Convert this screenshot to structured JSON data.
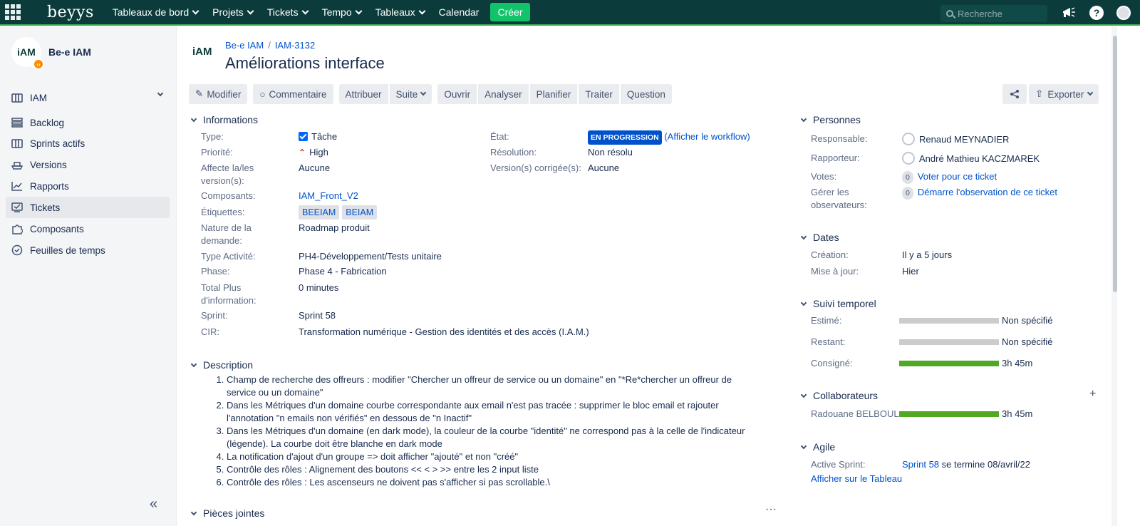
{
  "topnav": {
    "logo": "beyys",
    "items": [
      "Tableaux de bord",
      "Projets",
      "Tickets",
      "Tempo",
      "Tableaux"
    ],
    "calendar": "Calendar",
    "create": "Créer",
    "search_placeholder": "Recherche"
  },
  "sidebar": {
    "project_logo": "iAM",
    "project_name": "Be-e IAM",
    "board_selector": "IAM",
    "items": [
      {
        "label": "Backlog",
        "icon": "backlog-icon"
      },
      {
        "label": "Sprints actifs",
        "icon": "board-icon"
      },
      {
        "label": "Versions",
        "icon": "ship-icon"
      },
      {
        "label": "Rapports",
        "icon": "chart-icon"
      },
      {
        "label": "Tickets",
        "icon": "tickets-icon"
      },
      {
        "label": "Composants",
        "icon": "puzzle-icon"
      },
      {
        "label": "Feuilles de temps",
        "icon": "clock-icon"
      }
    ]
  },
  "issue": {
    "breadcrumb": [
      "Be-e IAM",
      "IAM-3132"
    ],
    "title": "Améliorations interface",
    "actions": [
      "Modifier",
      "Commentaire",
      "Attribuer",
      "Suite",
      "Ouvrir",
      "Analyser",
      "Planifier",
      "Traiter",
      "Question"
    ],
    "export": "Exporter"
  },
  "details": {
    "heading": "Informations",
    "type_label": "Type:",
    "type": "Tâche",
    "priority_label": "Priorité:",
    "priority": "High",
    "affects_label": "Affecte la/les version(s):",
    "affects": "Aucune",
    "components_label": "Composants:",
    "components": "IAM_Front_V2",
    "labels_label": "Étiquettes:",
    "labels": [
      "BEEIAM",
      "BEIAM"
    ],
    "nature_label": "Nature de la demande:",
    "nature": "Roadmap produit",
    "activity_label": "Type Activité:",
    "activity": "PH4-Développement/Tests unitaire",
    "phase_label": "Phase:",
    "phase": "Phase 4 - Fabrication",
    "total_label": "Total Plus d'information:",
    "total": "0 minutes",
    "sprint_label": "Sprint:",
    "sprint": "Sprint 58",
    "cir_label": "CIR:",
    "cir": "Transformation numérique - Gestion des identités et des accès (I.A.M.)",
    "state_label": "État:",
    "state": "EN PROGRESSION",
    "workflow": "(Afficher le workflow)",
    "resolution_label": "Résolution:",
    "resolution": "Non résolu",
    "fixversion_label": "Version(s) corrigée(s):",
    "fixversion": "Aucune"
  },
  "description": {
    "heading": "Description",
    "items": [
      "Champ de recherche des offreurs : modifier \"Chercher un offreur de service ou un domaine\" en \"*Re*chercher un offreur de service ou un domaine\"",
      "Dans les Métriques d'un domaine courbe correspondante aux email n'est pas tracée : supprimer le bloc email et rajouter l'annotation \"n emails non vérifiés\" en dessous de \"n Inactif\"",
      "Dans les Métriques d'un domaine (en dark mode), la couleur de la courbe \"identité\" ne correspond pas à la celle de l'indicateur (légende). La courbe doit être blanche en dark mode",
      "La notification d'ajout d'un groupe => doit afficher \"ajouté\" et non \"créé\"",
      "Contrôle des rôles : Alignement des boutons << < > >> entre les 2 input liste",
      "Contrôle des rôles : Les ascenseurs ne doivent pas s'afficher si pas scrollable.\\"
    ]
  },
  "attachments_heading": "Pièces jointes",
  "people": {
    "heading": "Personnes",
    "assignee_label": "Responsable:",
    "assignee": "Renaud MEYNADIER",
    "reporter_label": "Rapporteur:",
    "reporter": "André Mathieu KACZMAREK",
    "votes_label": "Votes:",
    "votes_count": "0",
    "votes_link": "Voter pour ce ticket",
    "watchers_label": "Gérer les observateurs:",
    "watchers_count": "0",
    "watchers_link": "Démarre l'observation de ce ticket"
  },
  "dates": {
    "heading": "Dates",
    "created_label": "Création:",
    "created": "Il y a 5 jours",
    "updated_label": "Mise à jour:",
    "updated": "Hier"
  },
  "time": {
    "heading": "Suivi temporel",
    "estimated_label": "Estimé:",
    "estimated": "Non spécifié",
    "estimated_fill": 0,
    "remaining_label": "Restant:",
    "remaining": "Non spécifié",
    "remaining_fill": 0,
    "logged_label": "Consigné:",
    "logged": "3h 45m",
    "logged_fill": 1
  },
  "collaborators": {
    "heading": "Collaborateurs",
    "name": "Radouane BELBOUL",
    "time": "3h 45m",
    "fill": 1
  },
  "agile": {
    "heading": "Agile",
    "active_label": "Active Sprint:",
    "sprint": "Sprint 58",
    "ends": "se termine 08/avril/22",
    "board_link": "Afficher sur le Tableau"
  }
}
